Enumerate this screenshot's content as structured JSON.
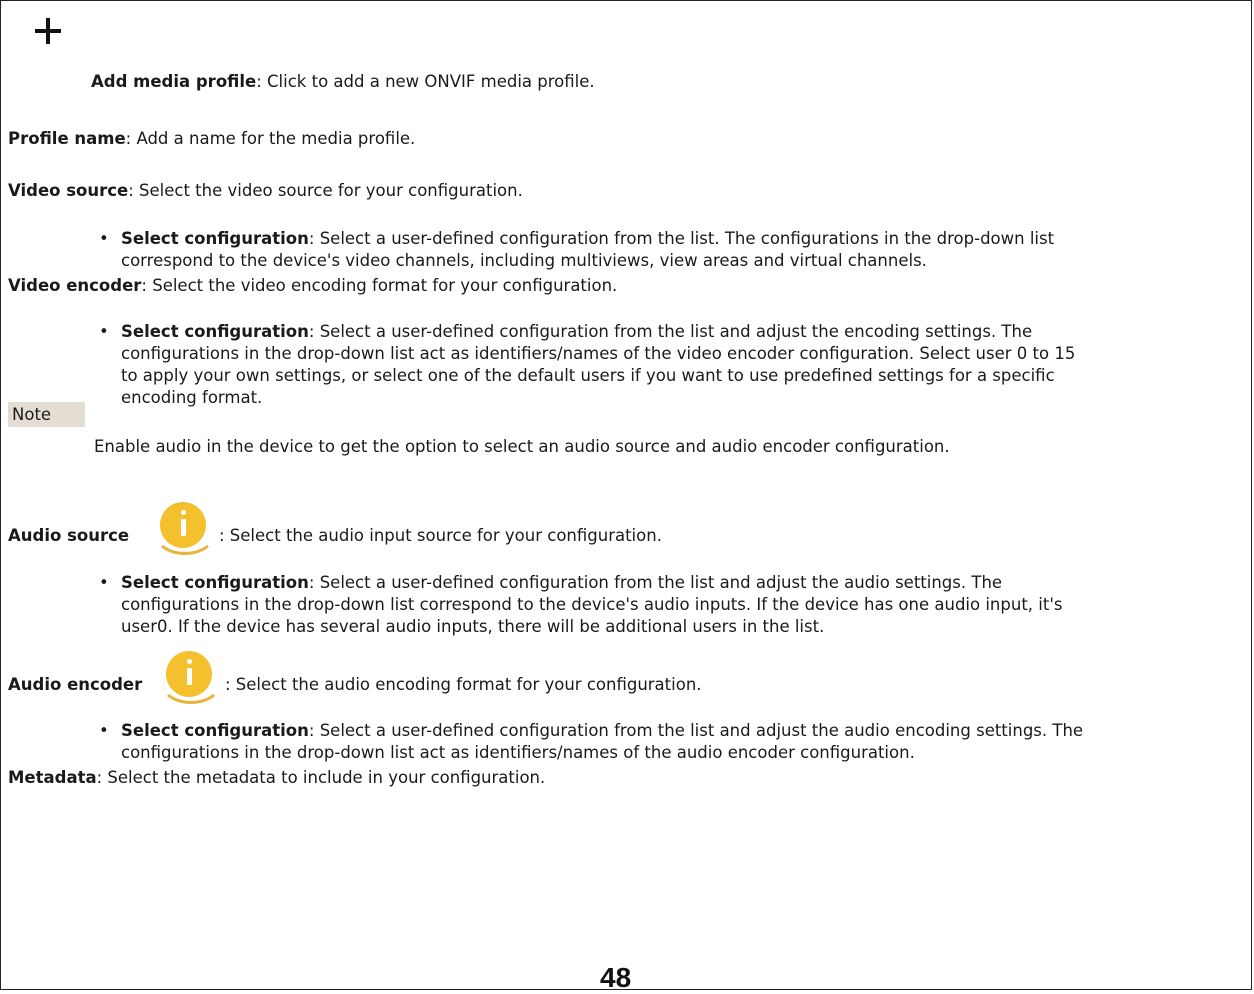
{
  "items": {
    "add_profile": {
      "label": "Add media profile",
      "text": ": Click to add a new ONVIF media profile."
    },
    "profile_name": {
      "label": "Profile name",
      "text": ": Add a name for the media profile."
    },
    "video_source": {
      "label": "Video source",
      "text": ": Select the video source for your configuration.",
      "bullet_label": "Select configuration",
      "bullet_lines": [
        ": Select a user-defined configuration from the list. The configurations in the drop-down list",
        "correspond to the device's video channels, including multiviews, view areas and virtual channels."
      ]
    },
    "video_encoder": {
      "label": "Video encoder",
      "text": ": Select the video encoding format for your configuration.",
      "bullet_label": "Select configuration",
      "bullet_lines": [
        ": Select a user-defined configuration from the list and adjust the encoding settings. The",
        "configurations in the drop-down list act as identifiers/names of the video encoder configuration. Select user 0 to 15",
        "to apply your own settings, or select one of the default users if you want to use predefined settings for a specific",
        "encoding format."
      ]
    },
    "note": {
      "label": "Note",
      "text": "Enable audio in the device to get the option to select an audio source and audio encoder configuration."
    },
    "audio_source": {
      "label": "Audio source",
      "text": ": Select the audio input source for your configuration.",
      "bullet_label": "Select configuration",
      "bullet_lines": [
        ": Select a user-defined configuration from the list and adjust the audio settings. The",
        "configurations in the drop-down list correspond to the device's audio inputs. If the device has one audio input, it's",
        "user0. If the device has several audio inputs, there will be additional users in the list."
      ]
    },
    "audio_encoder": {
      "label": "Audio encoder",
      "text": ": Select the audio encoding format for your configuration.",
      "bullet_label": "Select configuration",
      "bullet_lines": [
        ": Select a user-defined configuration from the list and adjust the audio encoding settings. The",
        "configurations in the drop-down list act as identifiers/names of the audio encoder configuration."
      ]
    },
    "metadata": {
      "label": "Metadata",
      "text": ": Select the metadata to include in your configuration."
    }
  },
  "page_number": "48"
}
